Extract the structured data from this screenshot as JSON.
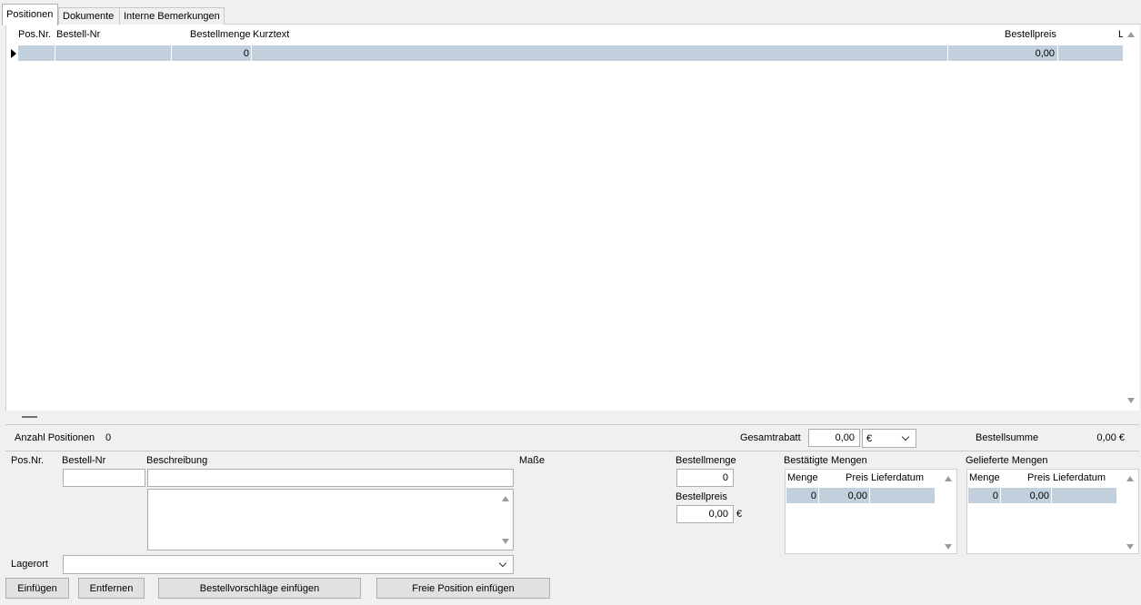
{
  "tabs": [
    "Positionen",
    "Dokumente",
    "Interne Bemerkungen"
  ],
  "grid": {
    "headers": [
      "Pos.Nr.",
      "Bestell-Nr",
      "Bestellmenge",
      "Kurztext",
      "Bestellpreis",
      "L"
    ],
    "row": {
      "posnr": "",
      "bestellnr": "",
      "bestellmenge": "0",
      "kurztext": "",
      "bestellpreis": "0,00"
    }
  },
  "summary": {
    "anzahl_label": "Anzahl Positionen",
    "anzahl_value": "0",
    "gesamtrabatt_label": "Gesamtrabatt",
    "gesamtrabatt_value": "0,00",
    "currency": "€",
    "bestellsumme_label": "Bestellsumme",
    "bestellsumme_value": "0,00 €"
  },
  "detail": {
    "posnr_label": "Pos.Nr.",
    "bestellnr_label": "Bestell-Nr",
    "beschreibung_label": "Beschreibung",
    "masse_label": "Maße",
    "bestellmenge_label": "Bestellmenge",
    "bestellmenge_value": "0",
    "bestellpreis_label": "Bestellpreis",
    "bestellpreis_value": "0,00",
    "currency": "€",
    "lagerort_label": "Lagerort"
  },
  "bestaetigte": {
    "title": "Bestätigte Mengen",
    "headers": [
      "Menge",
      "Preis",
      "Lieferdatum"
    ],
    "row": [
      "0",
      "0,00",
      ""
    ]
  },
  "gelieferte": {
    "title": "Gelieferte Mengen",
    "headers": [
      "Menge",
      "Preis",
      "Lieferdatum"
    ],
    "row": [
      "0",
      "0,00",
      ""
    ]
  },
  "buttons": {
    "einfuegen": "Einfügen",
    "entfernen": "Entfernen",
    "bestellvorschlaege": "Bestellvorschläge einfügen",
    "freie_position": "Freie Position einfügen"
  },
  "icons": [
    "row-indicator-icon",
    "scroll-up-icon",
    "scroll-down-icon",
    "chevron-down-icon"
  ]
}
